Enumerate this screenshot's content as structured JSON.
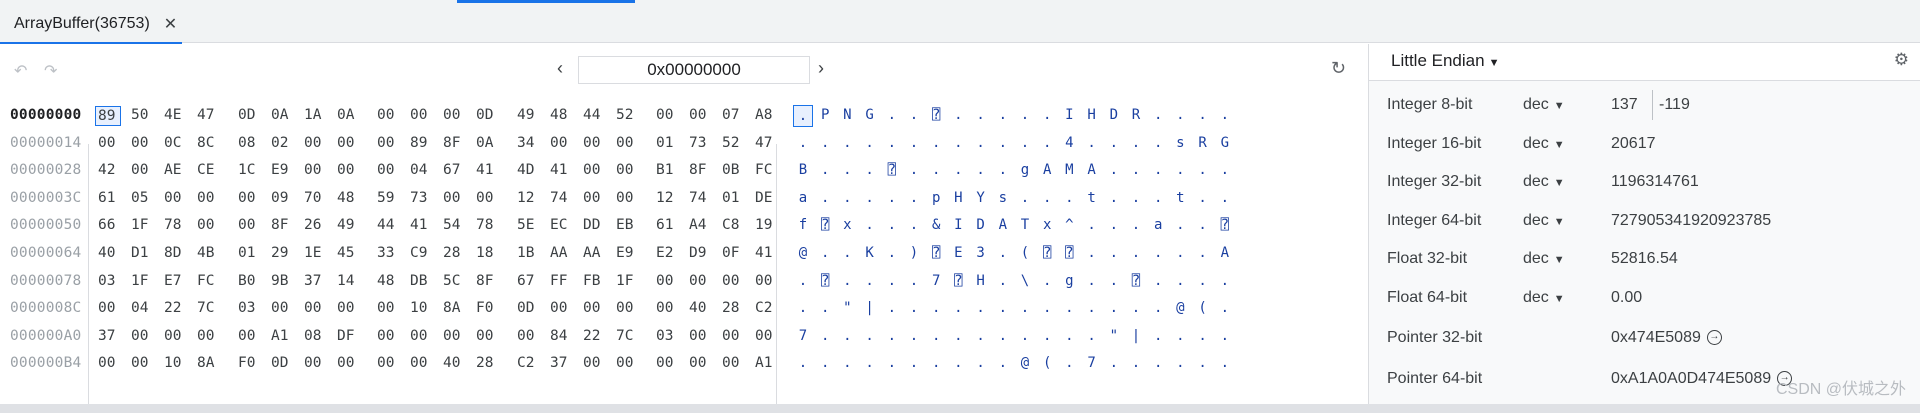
{
  "tab": {
    "label": "ArrayBuffer(36753)",
    "close": "✕"
  },
  "toolbar": {
    "address": "0x00000000",
    "prev": "‹",
    "next": "›"
  },
  "hex": {
    "rows": [
      {
        "offset": "00000000",
        "bytes": [
          "89",
          "50",
          "4E",
          "47",
          "0D",
          "0A",
          "1A",
          "0A",
          "00",
          "00",
          "00",
          "0D",
          "49",
          "48",
          "44",
          "52",
          "00",
          "00",
          "07",
          "A8"
        ],
        "chars": [
          ".",
          "P",
          "N",
          "G",
          ".",
          ".",
          "⍰",
          ".",
          ".",
          ".",
          ".",
          ".",
          "I",
          "H",
          "D",
          "R",
          ".",
          ".",
          ".",
          "."
        ]
      },
      {
        "offset": "00000014",
        "bytes": [
          "00",
          "00",
          "0C",
          "8C",
          "08",
          "02",
          "00",
          "00",
          "00",
          "89",
          "8F",
          "0A",
          "34",
          "00",
          "00",
          "00",
          "01",
          "73",
          "52",
          "47"
        ],
        "chars": [
          ".",
          ".",
          ".",
          ".",
          ".",
          ".",
          ".",
          ".",
          ".",
          ".",
          ".",
          ".",
          "4",
          ".",
          ".",
          ".",
          ".",
          "s",
          "R",
          "G"
        ]
      },
      {
        "offset": "00000028",
        "bytes": [
          "42",
          "00",
          "AE",
          "CE",
          "1C",
          "E9",
          "00",
          "00",
          "00",
          "04",
          "67",
          "41",
          "4D",
          "41",
          "00",
          "00",
          "B1",
          "8F",
          "0B",
          "FC"
        ],
        "chars": [
          "B",
          ".",
          ".",
          ".",
          "⍰",
          ".",
          ".",
          ".",
          ".",
          ".",
          "g",
          "A",
          "M",
          "A",
          ".",
          ".",
          ".",
          ".",
          ".",
          "."
        ]
      },
      {
        "offset": "0000003C",
        "bytes": [
          "61",
          "05",
          "00",
          "00",
          "00",
          "09",
          "70",
          "48",
          "59",
          "73",
          "00",
          "00",
          "12",
          "74",
          "00",
          "00",
          "12",
          "74",
          "01",
          "DE"
        ],
        "chars": [
          "a",
          ".",
          ".",
          ".",
          ".",
          ".",
          "p",
          "H",
          "Y",
          "s",
          ".",
          ".",
          ".",
          "t",
          ".",
          ".",
          ".",
          "t",
          ".",
          "."
        ]
      },
      {
        "offset": "00000050",
        "bytes": [
          "66",
          "1F",
          "78",
          "00",
          "00",
          "8F",
          "26",
          "49",
          "44",
          "41",
          "54",
          "78",
          "5E",
          "EC",
          "DD",
          "EB",
          "61",
          "A4",
          "C8",
          "19"
        ],
        "chars": [
          "f",
          "⍰",
          "x",
          ".",
          ".",
          ".",
          "&",
          "I",
          "D",
          "A",
          "T",
          "x",
          "^",
          ".",
          ".",
          ".",
          "a",
          ".",
          ".",
          "⍰"
        ]
      },
      {
        "offset": "00000064",
        "bytes": [
          "40",
          "D1",
          "8D",
          "4B",
          "01",
          "29",
          "1E",
          "45",
          "33",
          "C9",
          "28",
          "18",
          "1B",
          "AA",
          "AA",
          "E9",
          "E2",
          "D9",
          "0F",
          "41"
        ],
        "chars": [
          "@",
          ".",
          ".",
          "K",
          ".",
          ")",
          "⍰",
          "E",
          "3",
          ".",
          "(",
          "⍰",
          "⍰",
          ".",
          ".",
          ".",
          ".",
          ".",
          ".",
          "A"
        ]
      },
      {
        "offset": "00000078",
        "bytes": [
          "03",
          "1F",
          "E7",
          "FC",
          "B0",
          "9B",
          "37",
          "14",
          "48",
          "DB",
          "5C",
          "8F",
          "67",
          "FF",
          "FB",
          "1F",
          "00",
          "00",
          "00",
          "00"
        ],
        "chars": [
          ".",
          "⍰",
          ".",
          ".",
          ".",
          ".",
          "7",
          "⍰",
          "H",
          ".",
          "\\",
          ".",
          "g",
          ".",
          ".",
          "⍰",
          ".",
          ".",
          ".",
          "."
        ]
      },
      {
        "offset": "0000008C",
        "bytes": [
          "00",
          "04",
          "22",
          "7C",
          "03",
          "00",
          "00",
          "00",
          "00",
          "10",
          "8A",
          "F0",
          "0D",
          "00",
          "00",
          "00",
          "00",
          "40",
          "28",
          "C2"
        ],
        "chars": [
          ".",
          ".",
          "\"",
          "|",
          ".",
          ".",
          ".",
          ".",
          ".",
          ".",
          ".",
          ".",
          ".",
          ".",
          ".",
          ".",
          ".",
          "@",
          "(",
          "."
        ]
      },
      {
        "offset": "000000A0",
        "bytes": [
          "37",
          "00",
          "00",
          "00",
          "00",
          "A1",
          "08",
          "DF",
          "00",
          "00",
          "00",
          "00",
          "00",
          "84",
          "22",
          "7C",
          "03",
          "00",
          "00",
          "00"
        ],
        "chars": [
          "7",
          ".",
          ".",
          ".",
          ".",
          ".",
          ".",
          ".",
          ".",
          ".",
          ".",
          ".",
          ".",
          ".",
          "\"",
          "|",
          ".",
          ".",
          ".",
          "."
        ]
      },
      {
        "offset": "000000B4",
        "bytes": [
          "00",
          "00",
          "10",
          "8A",
          "F0",
          "0D",
          "00",
          "00",
          "00",
          "00",
          "40",
          "28",
          "C2",
          "37",
          "00",
          "00",
          "00",
          "00",
          "00",
          "A1"
        ],
        "chars": [
          ".",
          ".",
          ".",
          ".",
          ".",
          ".",
          ".",
          ".",
          ".",
          ".",
          "@",
          "(",
          ".",
          "7",
          ".",
          ".",
          ".",
          ".",
          ".",
          "."
        ]
      }
    ]
  },
  "inspector": {
    "endianness": "Little Endian",
    "rows": [
      {
        "label": "Integer 8-bit",
        "format": "dec",
        "value": "137",
        "value2": "-119"
      },
      {
        "label": "Integer 16-bit",
        "format": "dec",
        "value": "20617"
      },
      {
        "label": "Integer 32-bit",
        "format": "dec",
        "value": "1196314761"
      },
      {
        "label": "Integer 64-bit",
        "format": "dec",
        "value": "727905341920923785"
      },
      {
        "label": "Float 32-bit",
        "format": "dec",
        "value": "52816.54"
      },
      {
        "label": "Float 64-bit",
        "format": "dec",
        "value": "0.00"
      },
      {
        "label": "Pointer 32-bit",
        "format": "",
        "value": "0x474E5089"
      },
      {
        "label": "Pointer 64-bit",
        "format": "",
        "value": "0xA1A0A0D474E5089"
      }
    ]
  },
  "watermark": "CSDN @伏城之外",
  "icons": {
    "undo": "undo-icon",
    "redo": "redo-icon",
    "refresh": "refresh-icon",
    "gear": "gear-icon",
    "jump": "arrow-right-circle-icon"
  },
  "colors": {
    "accent": "#1a73e8",
    "char_text": "#1a3fa0"
  }
}
